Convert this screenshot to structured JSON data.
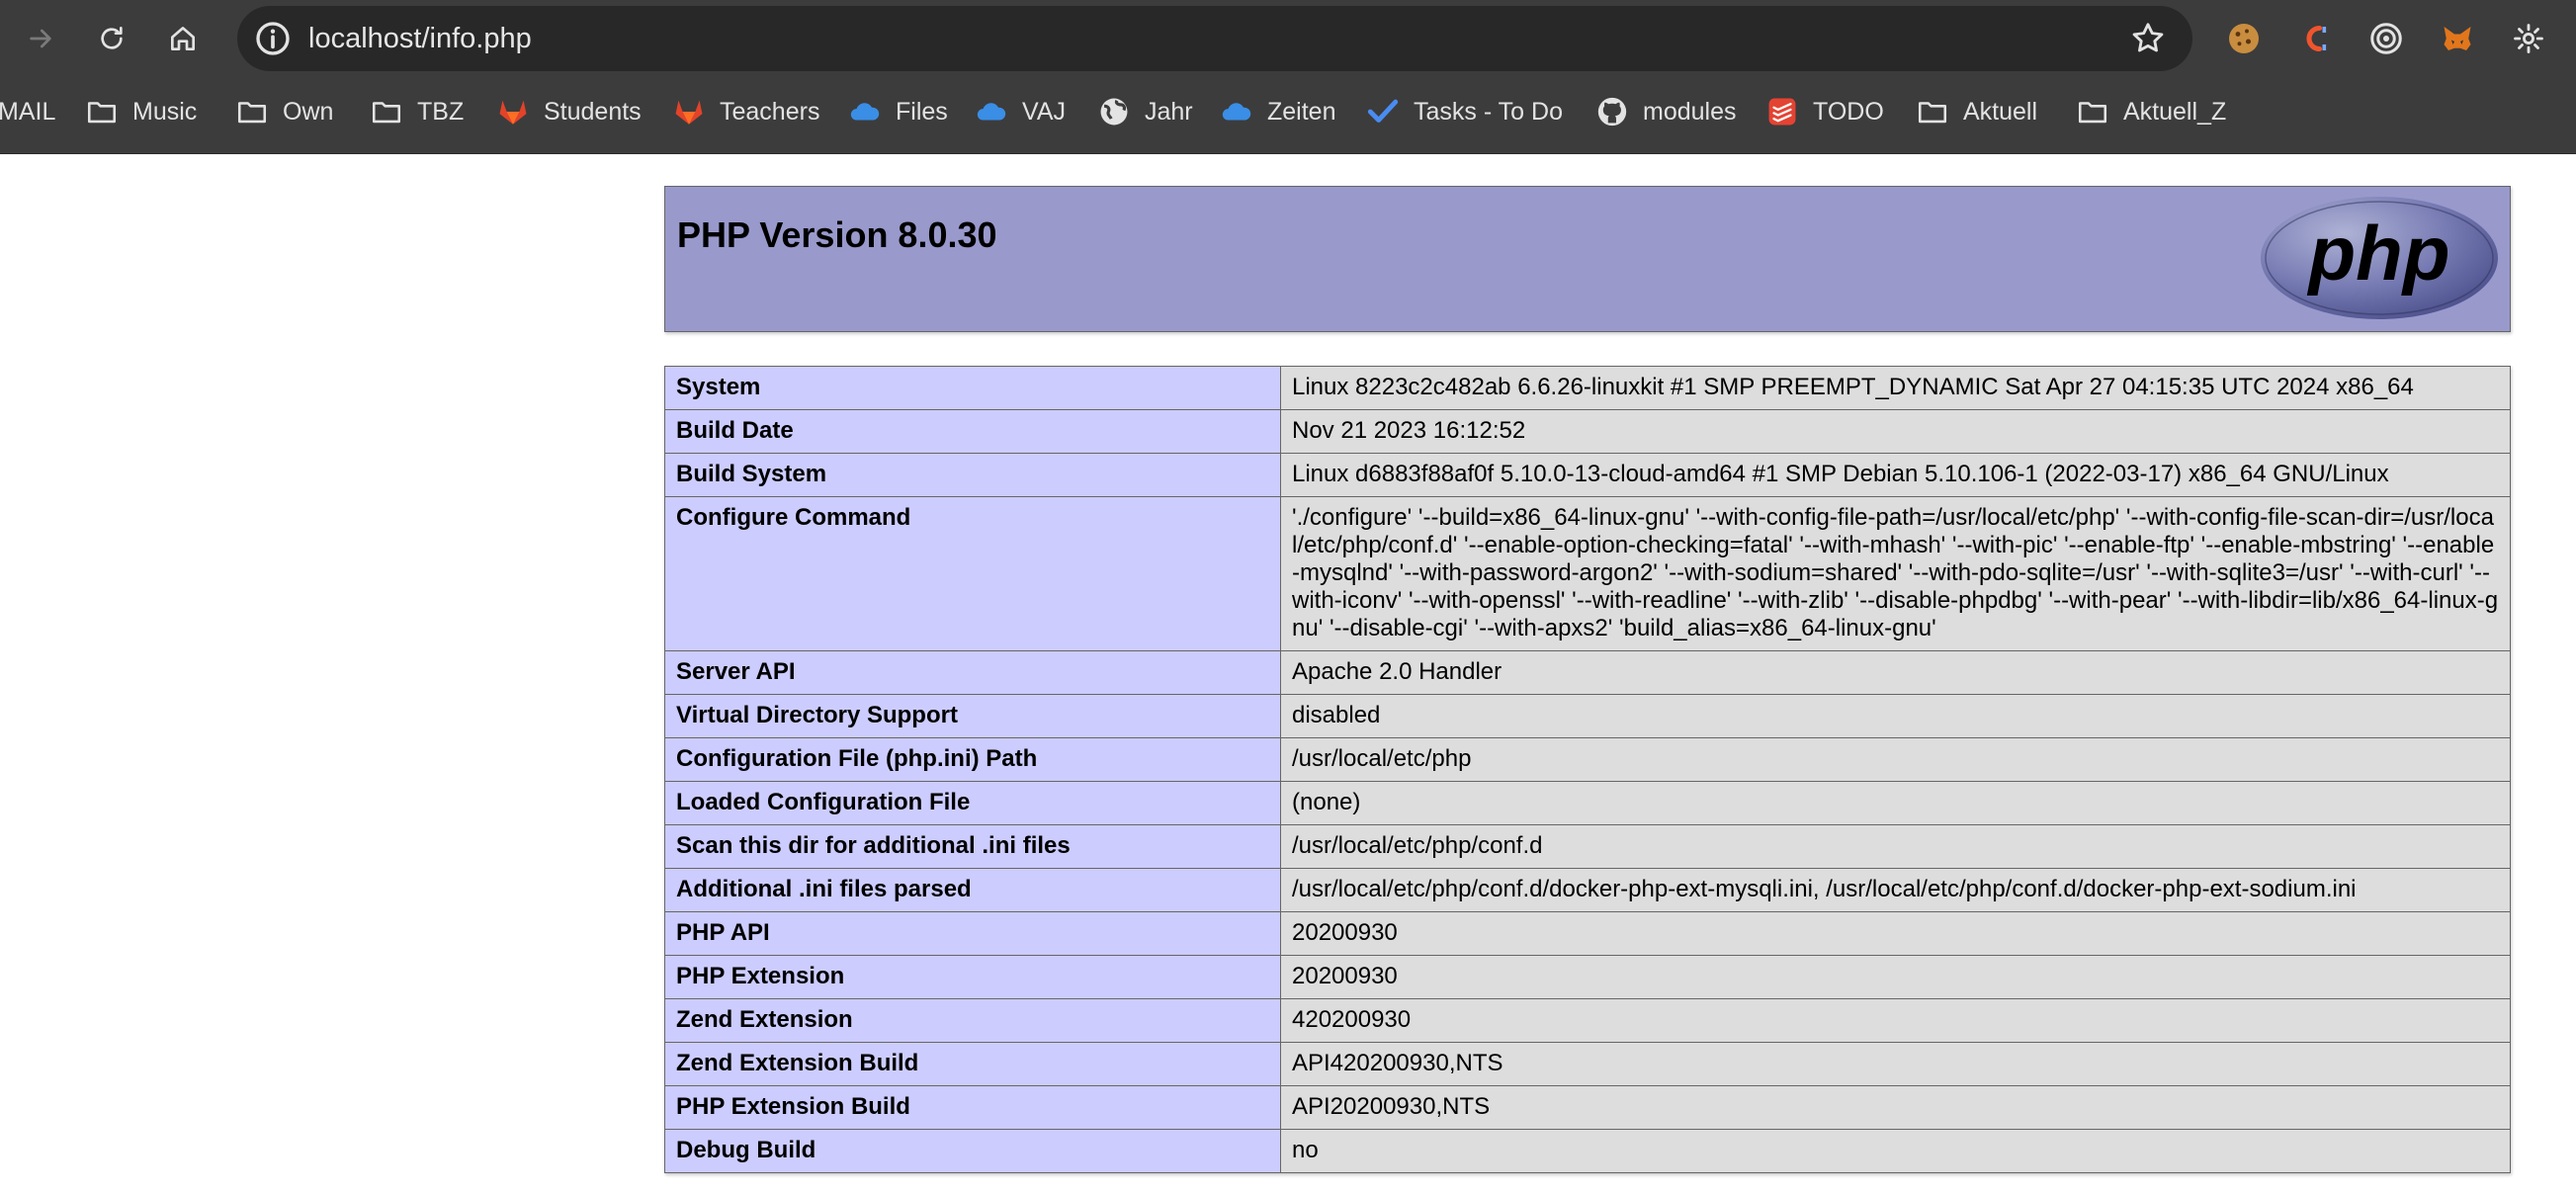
{
  "browser": {
    "url": "localhost/info.php",
    "bookmarks": [
      {
        "label": "MAIL",
        "icon": "mail-icon"
      },
      {
        "label": "Music",
        "icon": "folder-icon"
      },
      {
        "label": "Own",
        "icon": "folder-icon"
      },
      {
        "label": "TBZ",
        "icon": "folder-icon"
      },
      {
        "label": "Students",
        "icon": "gitlab-icon"
      },
      {
        "label": "Teachers",
        "icon": "gitlab-icon"
      },
      {
        "label": "Files",
        "icon": "onedrive-icon"
      },
      {
        "label": "VAJ",
        "icon": "onedrive-icon"
      },
      {
        "label": "Jahr",
        "icon": "globe-icon"
      },
      {
        "label": "Zeiten",
        "icon": "onedrive-icon"
      },
      {
        "label": "Tasks - To Do",
        "icon": "checkmark-icon"
      },
      {
        "label": "modules",
        "icon": "github-icon"
      },
      {
        "label": "TODO",
        "icon": "todoist-icon"
      },
      {
        "label": "Aktuell",
        "icon": "folder-icon"
      },
      {
        "label": "Aktuell_Z",
        "icon": "folder-icon"
      }
    ]
  },
  "phpinfo": {
    "title": "PHP Version 8.0.30",
    "logo_text": "php",
    "rows": [
      {
        "label": "System",
        "value": "Linux 8223c2c482ab 6.6.26-linuxkit #1 SMP PREEMPT_DYNAMIC Sat Apr 27 04:15:35 UTC 2024 x86_64"
      },
      {
        "label": "Build Date",
        "value": "Nov 21 2023 16:12:52"
      },
      {
        "label": "Build System",
        "value": "Linux d6883f88af0f 5.10.0-13-cloud-amd64 #1 SMP Debian 5.10.106-1 (2022-03-17) x86_64 GNU/Linux"
      },
      {
        "label": "Configure Command",
        "value": "'./configure' '--build=x86_64-linux-gnu' '--with-config-file-path=/usr/local/etc/php' '--with-config-file-scan-dir=/usr/local/etc/php/conf.d' '--enable-option-checking=fatal' '--with-mhash' '--with-pic' '--enable-ftp' '--enable-mbstring' '--enable-mysqlnd' '--with-password-argon2' '--with-sodium=shared' '--with-pdo-sqlite=/usr' '--with-sqlite3=/usr' '--with-curl' '--with-iconv' '--with-openssl' '--with-readline' '--with-zlib' '--disable-phpdbg' '--with-pear' '--with-libdir=lib/x86_64-linux-gnu' '--disable-cgi' '--with-apxs2' 'build_alias=x86_64-linux-gnu'"
      },
      {
        "label": "Server API",
        "value": "Apache 2.0 Handler"
      },
      {
        "label": "Virtual Directory Support",
        "value": "disabled"
      },
      {
        "label": "Configuration File (php.ini) Path",
        "value": "/usr/local/etc/php"
      },
      {
        "label": "Loaded Configuration File",
        "value": "(none)"
      },
      {
        "label": "Scan this dir for additional .ini files",
        "value": "/usr/local/etc/php/conf.d"
      },
      {
        "label": "Additional .ini files parsed",
        "value": "/usr/local/etc/php/conf.d/docker-php-ext-mysqli.ini, /usr/local/etc/php/conf.d/docker-php-ext-sodium.ini"
      },
      {
        "label": "PHP API",
        "value": "20200930"
      },
      {
        "label": "PHP Extension",
        "value": "20200930"
      },
      {
        "label": "Zend Extension",
        "value": "420200930"
      },
      {
        "label": "Zend Extension Build",
        "value": "API420200930,NTS"
      },
      {
        "label": "PHP Extension Build",
        "value": "API20200930,NTS"
      },
      {
        "label": "Debug Build",
        "value": "no"
      }
    ]
  },
  "colors": {
    "header_bg": "#9999cc",
    "label_bg": "#ccccff",
    "value_bg": "#dddddd",
    "chrome_bg": "#3c3c3c"
  }
}
